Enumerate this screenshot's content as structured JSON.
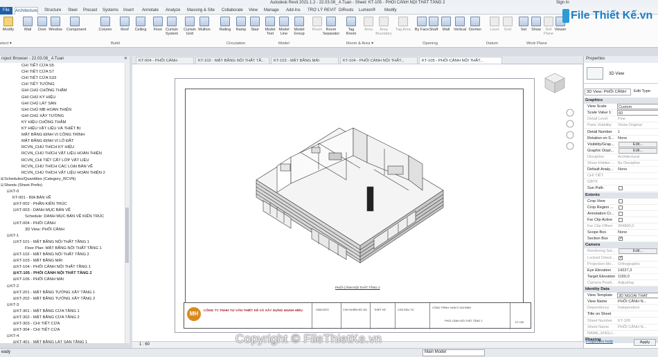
{
  "window": {
    "title": "Autodesk Revit 2021.1.2 - 22.03.08_ A Tuan - Sheet: KT-105 - PHỐI CẢNH NỘI THẤT TẦNG 2",
    "signin": "Sign In"
  },
  "tabs": [
    "File",
    "Architecture",
    "Structure",
    "Steel",
    "Precast",
    "Systems",
    "Insert",
    "Annotate",
    "Analyze",
    "Massing & Site",
    "Collaborate",
    "View",
    "Manage",
    "Add-Ins",
    "TRỢ LÝ REVIT",
    "DiRoots",
    "Lumion®",
    "Modify"
  ],
  "ribbon": {
    "buttons": [
      "Modify",
      "Wall",
      "Door",
      "Window",
      "Component",
      "Column",
      "Roof",
      "Ceiling",
      "Floor",
      "Curtain System",
      "Curtain Grid",
      "Mullion",
      "Railing",
      "Ramp",
      "Stair",
      "Model Text",
      "Model Line",
      "Model Group",
      "Room",
      "Room Separator",
      "Tag Room",
      "Area",
      "Area Boundary",
      "Tag Area",
      "By Face",
      "Shaft",
      "Wall",
      "Vertical",
      "Dormer",
      "Level",
      "Grid",
      "Set",
      "Show",
      "Ref Plane",
      "Viewer"
    ],
    "groups": [
      "elect ▾",
      "Build",
      "Circulation",
      "Model",
      "Room & Area ▾",
      "Opening",
      "Datum",
      "Work Plane"
    ]
  },
  "logo": "File Thiết Kế.vn",
  "project_browser": {
    "title": "roject Browser - 22.03.08_ A Tuan",
    "rows": [
      {
        "t": "CHI TIẾT CỬA S5",
        "l": 3
      },
      {
        "t": "CHI TIẾT CỬA S7",
        "l": 3
      },
      {
        "t": "CHI TIẾT CỬA S33",
        "l": 3
      },
      {
        "t": "CHI TIẾT TƯỜNG",
        "l": 3
      },
      {
        "t": "GHI CHÚ CHỐNG THẤM",
        "l": 3
      },
      {
        "t": "GHI CHÚ KÝ HIỆU",
        "l": 3
      },
      {
        "t": "GHI CHÚ LÁT SÀN",
        "l": 3
      },
      {
        "t": "GHI CHÚ MB HOÀN THIỆN",
        "l": 3
      },
      {
        "t": "GHI CHÚ XÂY TƯỜNG",
        "l": 3
      },
      {
        "t": "KÝ HIỆU CHỐNG THẤM",
        "l": 3
      },
      {
        "t": "KÝ HIỆU VẬT LIỆU VÀ THIẾT BỊ",
        "l": 3
      },
      {
        "t": "MẶT BẰNG ĐỊNH VỊ CÔNG TRÌNH",
        "l": 3
      },
      {
        "t": "MẶT BẰNG ĐỊNH VỊ LÔ ĐẤT",
        "l": 3
      },
      {
        "t": "RCVN_CHÚ THÍCH KÝ HIỆU",
        "l": 3
      },
      {
        "t": "RCVN_CHÚ THÍCH VẬT LIỆU HOÀN THIỆN",
        "l": 3
      },
      {
        "t": "RCVN_CHI TIẾT CẮT LỚP VẬT LIỆU",
        "l": 3
      },
      {
        "t": "RCVN_CHÚ THÍCH CÁC LOẠI BẢN VẼ",
        "l": 3
      },
      {
        "t": "RCVN_CHÚ THÍCH VẬT LIỆU HOÀN THIỆN 2",
        "l": 3
      },
      {
        "t": "Schedules/Quantities (Category_RCVN)",
        "l": 0,
        "g": "⊞"
      },
      {
        "t": "Sheets (Sheet Prefix)",
        "l": 0,
        "g": "⊟"
      },
      {
        "t": "KT-0",
        "l": 1,
        "g": "⊟"
      },
      {
        "t": "KT-001 - BÌA BẢN VẼ",
        "l": 2
      },
      {
        "t": "KT-002 - PHẦN KIẾN TRÚC",
        "l": 2,
        "g": "⊞"
      },
      {
        "t": "KT-003 - DANH MỤC BẢN VẼ",
        "l": 2,
        "g": "⊟"
      },
      {
        "t": "Schedule: DANH MỤC BẢN VẼ KIẾN TRÚC",
        "l": 4
      },
      {
        "t": "KT-004 - PHỐI CẢNH",
        "l": 2,
        "g": "⊟"
      },
      {
        "t": "3D View: PHỐI CẢNH",
        "l": 4
      },
      {
        "t": "KT-1",
        "l": 1,
        "g": "⊟"
      },
      {
        "t": "KT-101 - MẶT BẰNG NỘI THẤT TẦNG 1",
        "l": 2,
        "g": "⊟"
      },
      {
        "t": "Floor Plan: MẶT BẰNG NỘI THẤT TẦNG 1",
        "l": 4
      },
      {
        "t": "KT-102 - MẶT BẰNG NỘI THẤT TẦNG 2",
        "l": 2,
        "g": "⊞"
      },
      {
        "t": "KT-103 - MẶT BẰNG MÁI",
        "l": 2,
        "g": "⊞"
      },
      {
        "t": "KT-104 - PHỐI CẢNH NỘI THẤT TẦNG 1",
        "l": 2,
        "g": "⊞"
      },
      {
        "t": "KT-105 - PHỐI CẢNH NỘI THẤT TẦNG 2",
        "l": 2,
        "g": "⊞",
        "b": true
      },
      {
        "t": "KT-106 - PHỐI CẢNH MÁI",
        "l": 2,
        "g": "⊞"
      },
      {
        "t": "KT-2",
        "l": 1,
        "g": "⊟"
      },
      {
        "t": "KT-201 - MẶT BẰNG TƯỜNG XÂY TẦNG 1",
        "l": 2,
        "g": "⊞"
      },
      {
        "t": "KT-202 - MẶT BẰNG TƯỜNG XÂY TẦNG 2",
        "l": 2,
        "g": "⊞"
      },
      {
        "t": "KT-3",
        "l": 1,
        "g": "⊟"
      },
      {
        "t": "KT-301 - MẶT BẰNG CỬA TẦNG 1",
        "l": 2,
        "g": "⊞"
      },
      {
        "t": "KT-302 - MẶT BẰNG CỬA TẦNG 2",
        "l": 2,
        "g": "⊞"
      },
      {
        "t": "KT-303 - CHI TIẾT CỬA",
        "l": 2,
        "g": "⊞"
      },
      {
        "t": "KT-304 - CHI TIẾT CỬA",
        "l": 2,
        "g": "⊞"
      },
      {
        "t": "KT-4",
        "l": 1,
        "g": "⊟"
      },
      {
        "t": "KT-401 - MẶT BẰNG LÁT SÀN TẦNG 1",
        "l": 2,
        "g": "⊞"
      },
      {
        "t": "KT-402 - MẶT BẰNG LÁT SÀN TẦNG 2",
        "l": 2,
        "g": "⊞"
      }
    ]
  },
  "doc_tabs": [
    "KT-004 - PHỐI CẢNH",
    "KT-102 - MẶT BẰNG NỘI THẤT TẦ...",
    "KT-103 - MẶT BẰNG MÁI",
    "KT-104 - PHỐI CẢNH NỘI THẤT...",
    "KT-105 - PHỐI CẢNH NỘI THẤT..."
  ],
  "sheet": {
    "view_title": "PHỐI CẢNH NỘI THẤT TẦNG 2",
    "company": "CÔNG TY TNHH TƯ VẤN THIẾT KẾ VÀ XÂY DỰNG MẠNH HIẾU",
    "logo": "MH",
    "tb_labels": [
      "GIÁM ĐỐC",
      "CHỦ NHIỆM ĐỒ ÁN",
      "THIẾT KẾ",
      "CHỦ ĐẦU TƯ",
      "CÔNG TRÌNH: NHÀ Ở GIA ĐÌNH",
      "PHỐI CẢNH NỘI THẤT TẦNG 2",
      "KT-105"
    ]
  },
  "view_controls": {
    "scale": "1 : 60"
  },
  "status": {
    "left": "eady",
    "model": "Main Model"
  },
  "watermark": "Copyright © FileThietKe.vn",
  "properties": {
    "title": "Properties",
    "type_name": "3D View",
    "selector": "3D View: PHỐI CẢNH",
    "edit_type": "Edit Type",
    "help": "Properties help",
    "apply": "Apply",
    "sections": [
      {
        "name": "Graphics",
        "rows": [
          {
            "k": "View Scale",
            "v": "Custom",
            "box": true
          },
          {
            "k": "Scale Value   1:",
            "v": "60",
            "box": true
          },
          {
            "k": "Detail Level",
            "v": "Fine",
            "dim": true
          },
          {
            "k": "Parts Visibility",
            "v": "Show Original",
            "dim": true
          },
          {
            "k": "Detail Number",
            "v": "1"
          },
          {
            "k": "Rotation on S...",
            "v": "None"
          },
          {
            "k": "Visibility/Grap...",
            "btn": "Edit..."
          },
          {
            "k": "Graphic Displ...",
            "btn": "Edit..."
          },
          {
            "k": "Discipline",
            "v": "Architectural",
            "dim": true
          },
          {
            "k": "Show Hidden ...",
            "v": "By Discipline",
            "dim": true
          },
          {
            "k": "Default Analy...",
            "v": "None"
          },
          {
            "k": "CHI TIẾT",
            "v": "",
            "dim": true
          },
          {
            "k": "GBTK",
            "v": "",
            "dim": true
          },
          {
            "k": "Sun Path",
            "cb": false
          }
        ]
      },
      {
        "name": "Extents",
        "rows": [
          {
            "k": "Crop View",
            "cb": false
          },
          {
            "k": "Crop Region ...",
            "cb": false
          },
          {
            "k": "Annotation Cr...",
            "cb": false
          },
          {
            "k": "Far Clip Active",
            "cb": false
          },
          {
            "k": "Far Clip Offset",
            "v": "304800,0",
            "dim": true
          },
          {
            "k": "Scope Box",
            "v": "None"
          },
          {
            "k": "Section Box",
            "cb": true
          }
        ]
      },
      {
        "name": "Camera",
        "rows": [
          {
            "k": "Rendering Set...",
            "btn": "Edit...",
            "dim": true
          },
          {
            "k": "Locked Orient...",
            "cb": true,
            "dim": true
          },
          {
            "k": "Projection Mo...",
            "v": "Orthographic",
            "dim": true
          },
          {
            "k": "Eye Elevation",
            "v": "14227,3"
          },
          {
            "k": "Target Elevation",
            "v": "1150,0"
          },
          {
            "k": "Camera Positi...",
            "v": "Adjusting",
            "dim": true
          }
        ]
      },
      {
        "name": "Identity Data",
        "rows": [
          {
            "k": "View Template",
            "v": "3D NGOAI THAT",
            "box": true
          },
          {
            "k": "View Name",
            "v": "PHỐI CẢNH N..."
          },
          {
            "k": "Dependency",
            "v": "Independent",
            "dim": true
          },
          {
            "k": "Title on Sheet",
            "v": ""
          },
          {
            "k": "Sheet Number",
            "v": "KT-105",
            "dim": true
          },
          {
            "k": "Sheet Name",
            "v": "PHỐI CẢNH N...",
            "dim": true
          },
          {
            "k": "NAME_ENGLI...",
            "v": "",
            "dim": true
          }
        ]
      },
      {
        "name": "Phasing",
        "rows": []
      }
    ]
  }
}
